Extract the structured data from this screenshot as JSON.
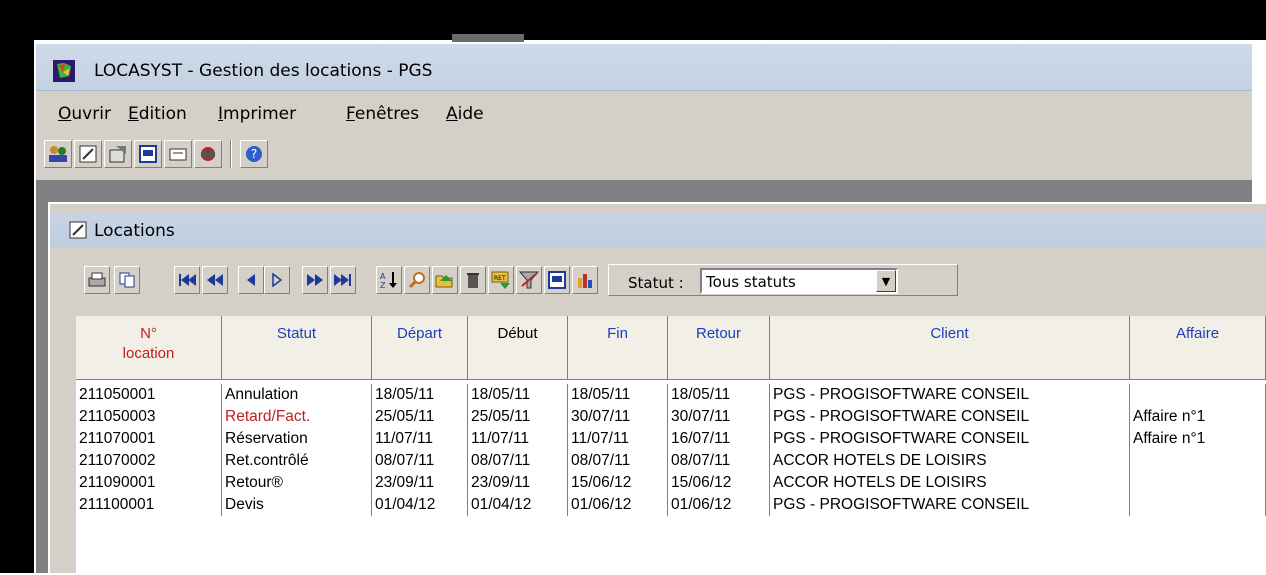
{
  "window": {
    "title": "LOCASYST - Gestion des locations - PGS"
  },
  "menu": [
    "Ouvrir",
    "Edition",
    "Imprimer",
    "Fenêtres",
    "Aide"
  ],
  "toolbar_icons": [
    "clients-icon",
    "locations-icon",
    "materiel-icon",
    "planning-icon",
    "tarifs-icon",
    "gestion-icon",
    "help-icon"
  ],
  "child_window": {
    "title": "Locations",
    "status_label": "Statut :",
    "status_value": "Tous statuts"
  },
  "grid": {
    "columns": [
      "N°\nlocation",
      "Statut",
      "Départ",
      "Début",
      "Fin",
      "Retour",
      "Client",
      "Affaire"
    ],
    "rows": [
      {
        "num": "211050001",
        "statut": "Annulation",
        "depart": "18/05/11",
        "debut": "18/05/11",
        "fin": "18/05/11",
        "retour": "18/05/11",
        "client": "PGS - PROGISOFTWARE CONSEIL",
        "affaire": ""
      },
      {
        "num": "211050003",
        "statut": "Retard/Fact.",
        "depart": "25/05/11",
        "debut": "25/05/11",
        "fin": "30/07/11",
        "retour": "30/07/11",
        "client": "PGS - PROGISOFTWARE CONSEIL",
        "affaire": "Affaire n°1"
      },
      {
        "num": "211070001",
        "statut": "Réservation",
        "depart": "11/07/11",
        "debut": "11/07/11",
        "fin": "11/07/11",
        "retour": "16/07/11",
        "client": "PGS - PROGISOFTWARE CONSEIL",
        "affaire": "Affaire n°1"
      },
      {
        "num": "211070002",
        "statut": "Ret.contrôlé",
        "depart": "08/07/11",
        "debut": "08/07/11",
        "fin": "08/07/11",
        "retour": "08/07/11",
        "client": "ACCOR HOTELS DE LOISIRS",
        "affaire": ""
      },
      {
        "num": "211090001",
        "statut": "Retour®",
        "depart": "23/09/11",
        "debut": "23/09/11",
        "fin": "15/06/12",
        "retour": "15/06/12",
        "client": "ACCOR HOTELS DE LOISIRS",
        "affaire": ""
      },
      {
        "num": "211100001",
        "statut": "Devis",
        "depart": "01/04/12",
        "debut": "01/04/12",
        "fin": "01/06/12",
        "retour": "01/06/12",
        "client": "PGS - PROGISOFTWARE CONSEIL",
        "affaire": ""
      }
    ]
  },
  "colors": {
    "status_red": "#c0201f",
    "header_blue": "#1e3dbc"
  }
}
